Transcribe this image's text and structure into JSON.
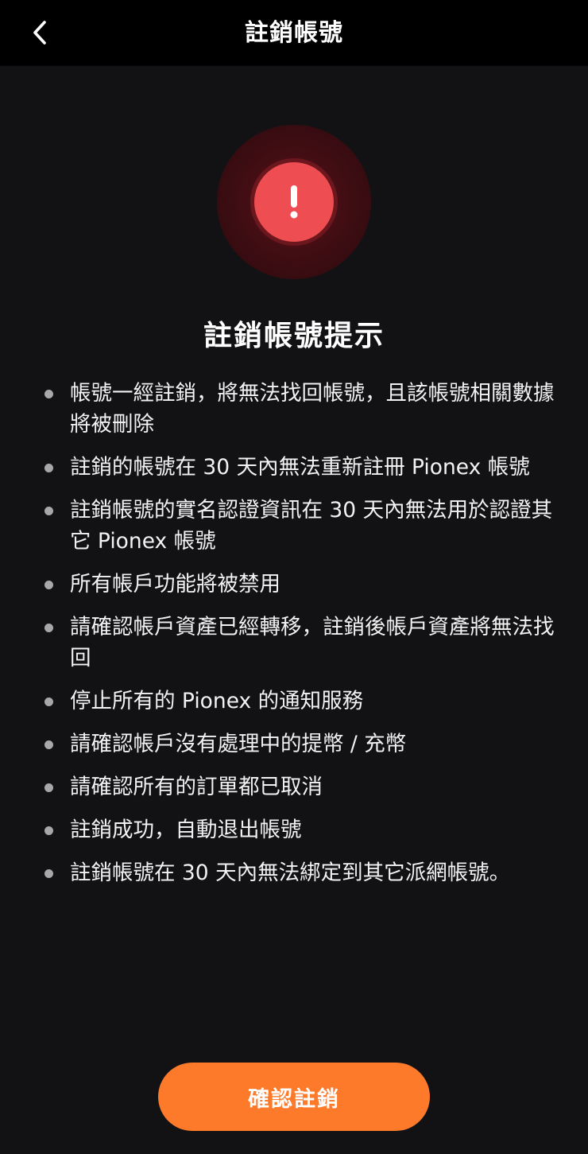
{
  "header": {
    "title": "註銷帳號",
    "back_icon": "chevron-left-icon"
  },
  "alert": {
    "icon": "exclamation-icon",
    "color": "#ee4d52",
    "heading": "註銷帳號提示"
  },
  "notices": [
    "帳號一經註銷，將無法找回帳號，且該帳號相關數據將被刪除",
    "註銷的帳號在 30 天內無法重新註冊 Pionex 帳號",
    "註銷帳號的實名認證資訊在 30 天內無法用於認證其它 Pionex 帳號",
    "所有帳戶功能將被禁用",
    "請確認帳戶資產已經轉移，註銷後帳戶資產將無法找回",
    "停止所有的 Pionex 的通知服務",
    "請確認帳戶沒有處理中的提幣 / 充幣",
    "請確認所有的訂單都已取消",
    "註銷成功，自動退出帳號",
    "註銷帳號在 30 天內無法綁定到其它派網帳號。"
  ],
  "confirm_button": {
    "label": "確認註銷",
    "color": "#fd7a2b"
  }
}
